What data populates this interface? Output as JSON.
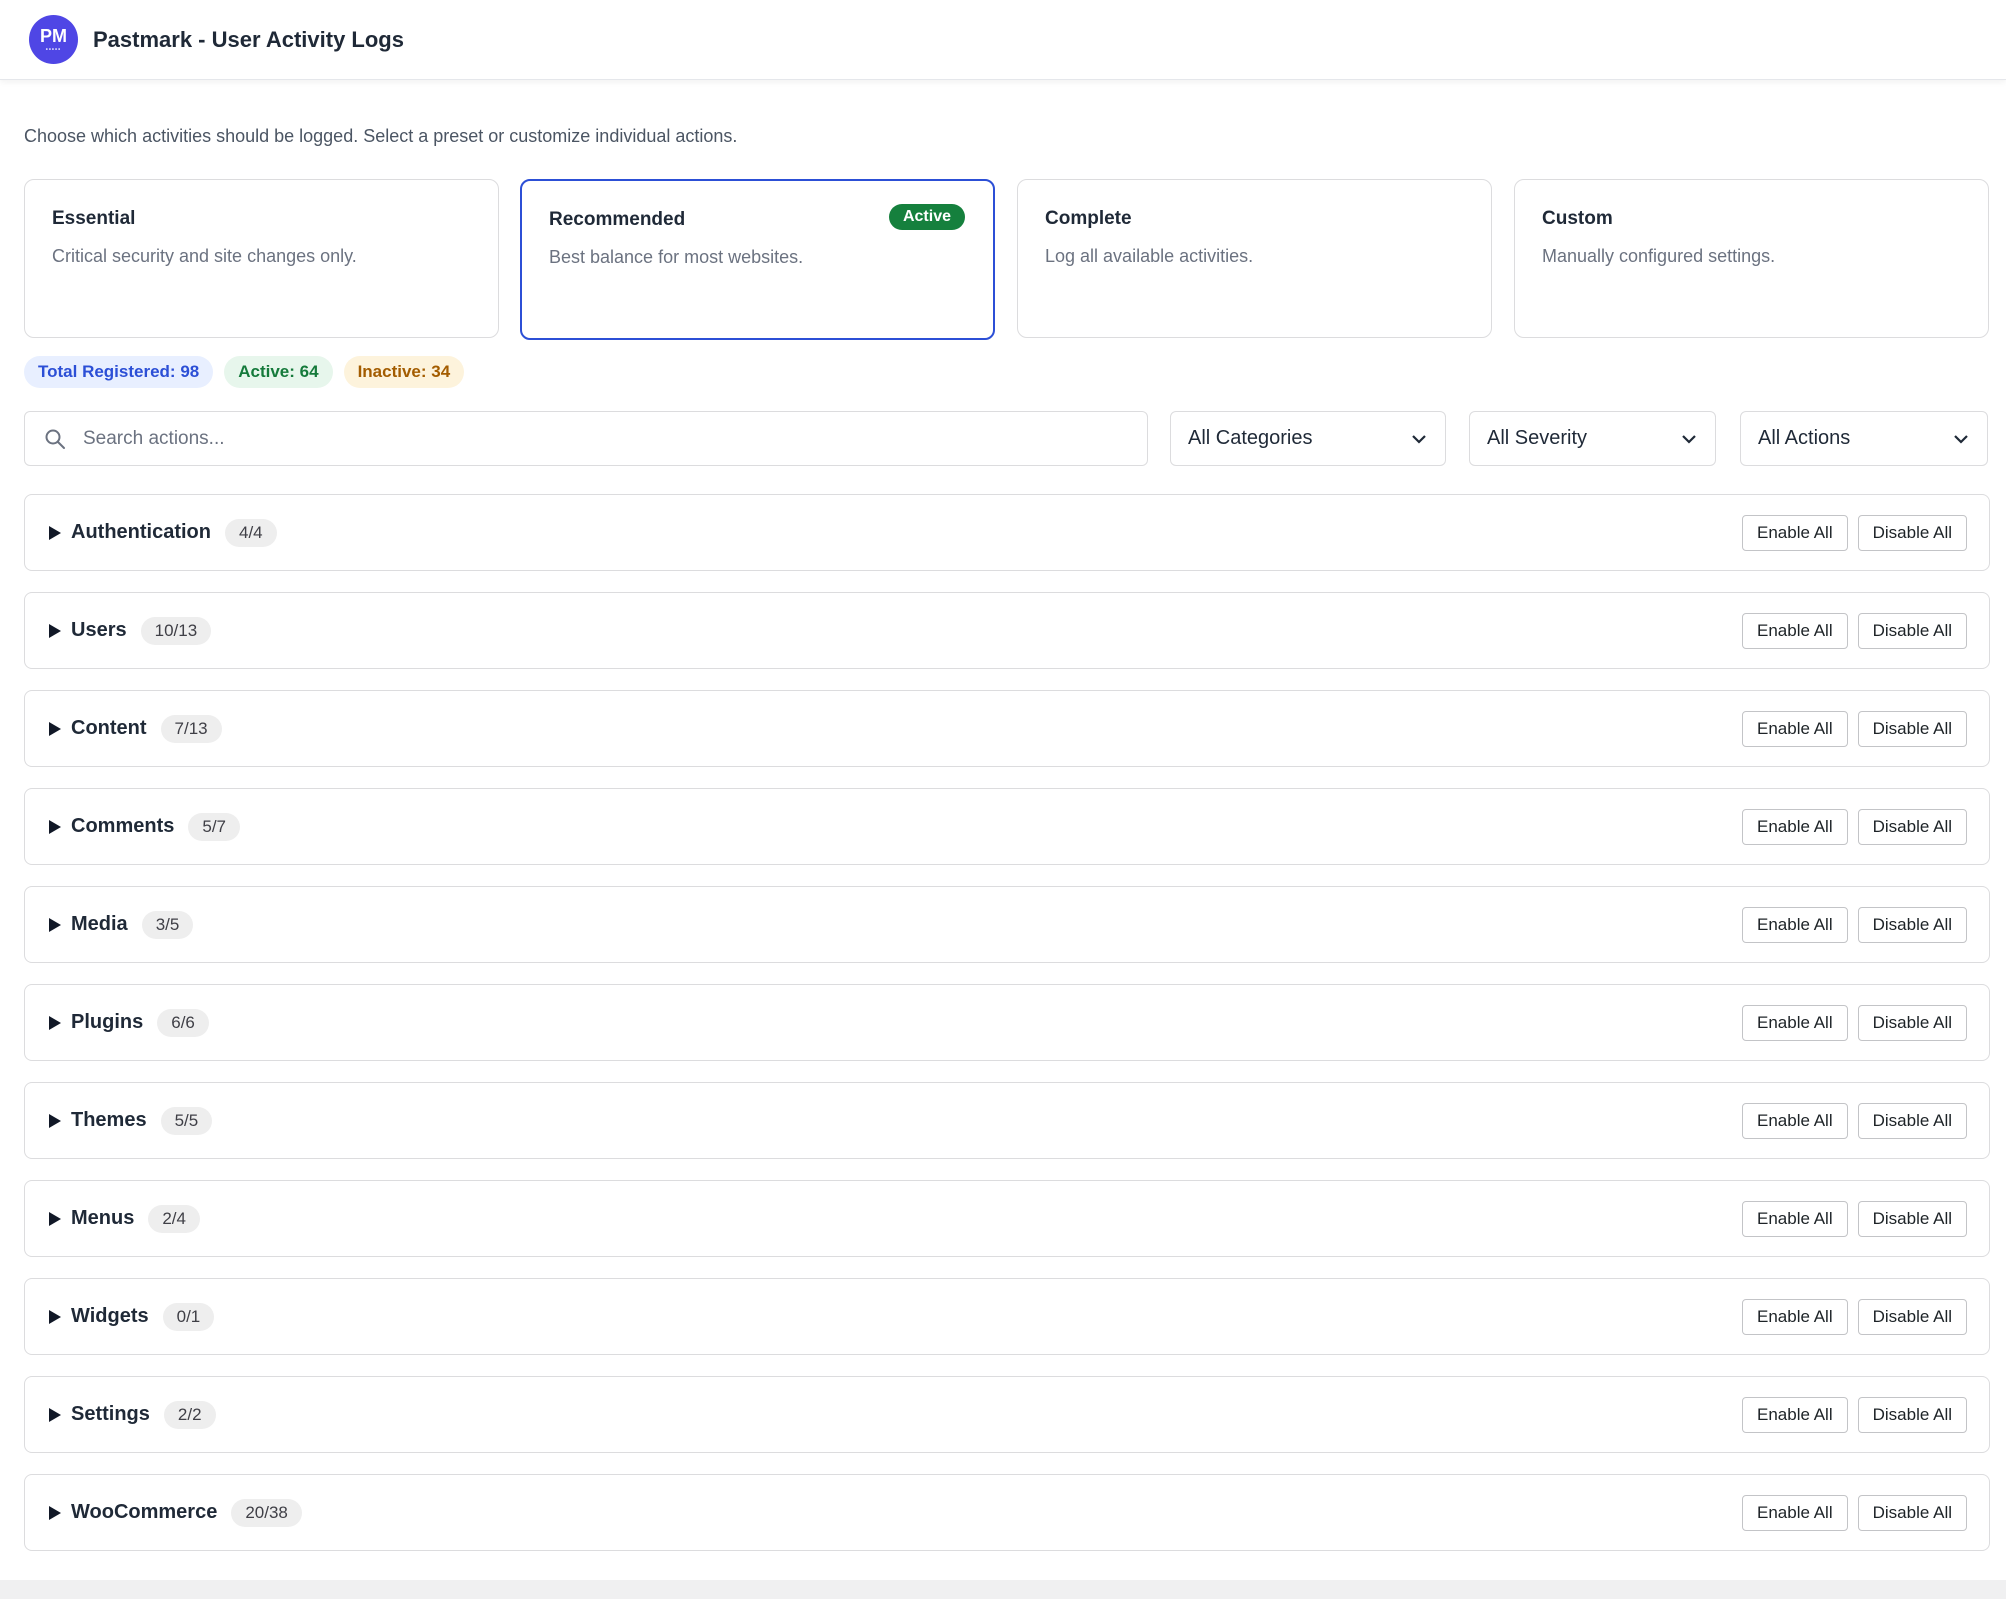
{
  "app": {
    "logo_text": "PM",
    "title": "Pastmark - User Activity Logs"
  },
  "intro": "Choose which activities should be logged. Select a preset or customize individual actions.",
  "presets": [
    {
      "name": "Essential",
      "description": "Critical security and site changes only.",
      "active": false
    },
    {
      "name": "Recommended",
      "description": "Best balance for most websites.",
      "active": true
    },
    {
      "name": "Complete",
      "description": "Log all available activities.",
      "active": false
    },
    {
      "name": "Custom",
      "description": "Manually configured settings.",
      "active": false
    }
  ],
  "active_badge": "Active",
  "counts": {
    "total": "Total Registered: 98",
    "active": "Active: 64",
    "inactive": "Inactive: 34"
  },
  "filters": {
    "search_placeholder": "Search actions...",
    "category": "All Categories",
    "severity": "All Severity",
    "actions": "All Actions"
  },
  "buttons": {
    "enable_all": "Enable All",
    "disable_all": "Disable All"
  },
  "categories": [
    {
      "name": "Authentication",
      "count": "4/4"
    },
    {
      "name": "Users",
      "count": "10/13"
    },
    {
      "name": "Content",
      "count": "7/13"
    },
    {
      "name": "Comments",
      "count": "5/7"
    },
    {
      "name": "Media",
      "count": "3/5"
    },
    {
      "name": "Plugins",
      "count": "6/6"
    },
    {
      "name": "Themes",
      "count": "5/5"
    },
    {
      "name": "Menus",
      "count": "2/4"
    },
    {
      "name": "Widgets",
      "count": "0/1"
    },
    {
      "name": "Settings",
      "count": "2/2"
    },
    {
      "name": "WooCommerce",
      "count": "20/38"
    }
  ],
  "colors": {
    "brand": "#4f46e5",
    "active_border": "#2c4fd6",
    "active_badge": "#15803d"
  },
  "icons": {
    "logo": "pm-logo",
    "search": "search-icon",
    "dropdown": "chevron-down-icon",
    "expand": "caret-right-icon"
  }
}
